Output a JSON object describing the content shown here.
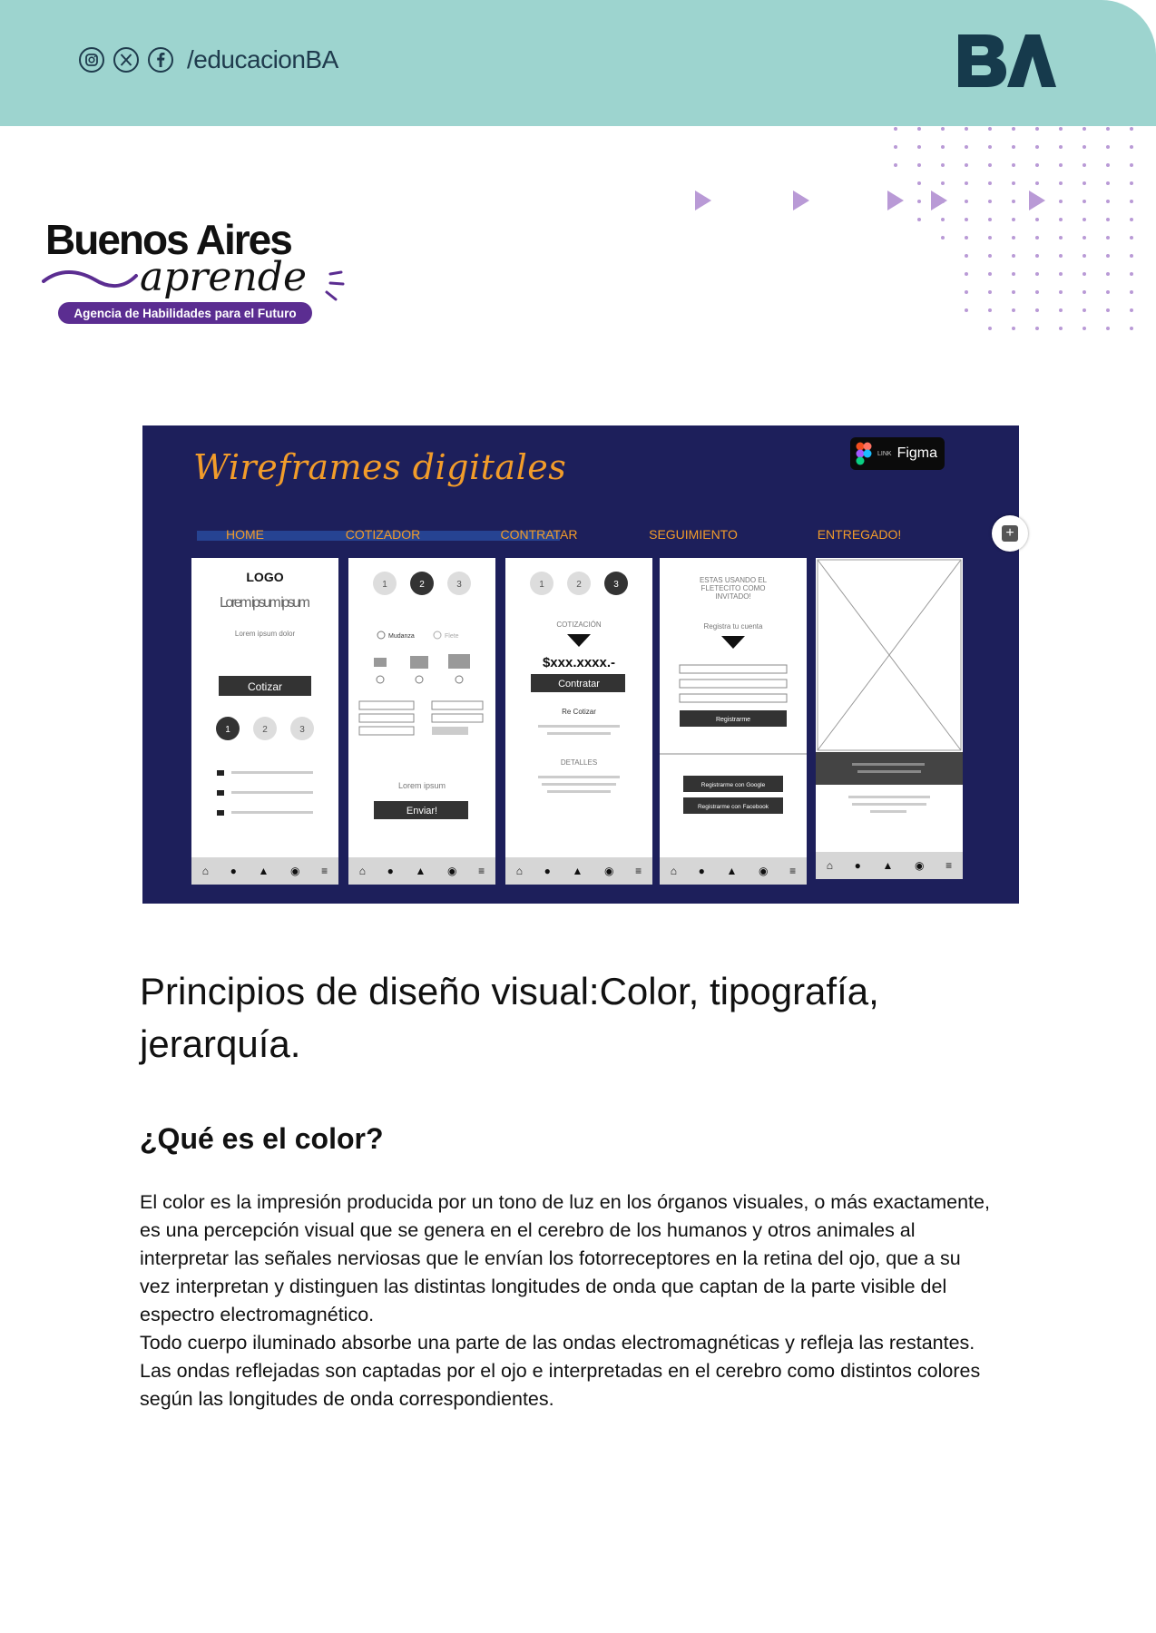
{
  "header": {
    "handle": "/educacionBA",
    "social_icons": [
      "instagram-icon",
      "x-icon",
      "facebook-icon"
    ],
    "logo_text": "BA",
    "band_color": "#9dd4cf",
    "logo_color": "#163a4c"
  },
  "brand": {
    "line1": "Buenos Aires",
    "line2": "aprende",
    "tagline": "Agencia de Habilidades para el Futuro",
    "accent": "#5b2d91"
  },
  "wireframe": {
    "title": "Wireframes digitales",
    "figma_small": "LINK",
    "figma_label": "Figma",
    "tabs": [
      "HOME",
      "COTIZADOR",
      "CONTRATAR",
      "SEGUIMIENTO",
      "ENTREGADO!"
    ],
    "home": {
      "logo": "LOGO",
      "headline": "Lorem ipsum ipsum",
      "sub": "Lorem ipsum dolor",
      "button": "Cotizar",
      "steps": [
        "1",
        "2",
        "3"
      ]
    },
    "cotizador": {
      "steps": [
        "1",
        "2",
        "3"
      ],
      "option1": "Mudanza",
      "option2": "Flete",
      "lorem": "Lorem ipsum",
      "button": "Enviar!"
    },
    "contratar": {
      "steps": [
        "1",
        "2",
        "3"
      ],
      "label": "COTIZACIÓN",
      "price": "$xxx.xxxx.-",
      "button": "Contratar",
      "recotizar": "Re Cotizar",
      "detalles": "DETALLES"
    },
    "seguimiento": {
      "notice": "ESTAS USANDO EL FLETECITO COMO INVITADO!",
      "register": "Registra tu cuenta",
      "button": "Registrarme",
      "google": "Registrarme con Google",
      "facebook": "Registrarme con Facebook"
    },
    "colors": {
      "background": "#1d1f5b",
      "accent": "#f29c2a"
    }
  },
  "content": {
    "title": "Principios de diseño visual:Color, tipografía, jerarquía.",
    "subtitle": "¿Qué es el color?",
    "paragraph1": "El color es la impresión producida por un tono de luz en los órganos visuales, o más exactamente, es una percepción visual que se genera en el cerebro de los humanos y otros animales al interpretar las señales nerviosas que le envían los fotorreceptores en la retina del ojo, que a su vez interpretan y distinguen las distintas longitudes de onda que captan de la parte visible del espectro electromagnético.",
    "paragraph2": "Todo cuerpo iluminado absorbe una parte de las ondas electromagnéticas y refleja las restantes. Las ondas reflejadas son captadas por el ojo e interpretadas en el cerebro como distintos colores según las longitudes de onda correspondientes."
  }
}
